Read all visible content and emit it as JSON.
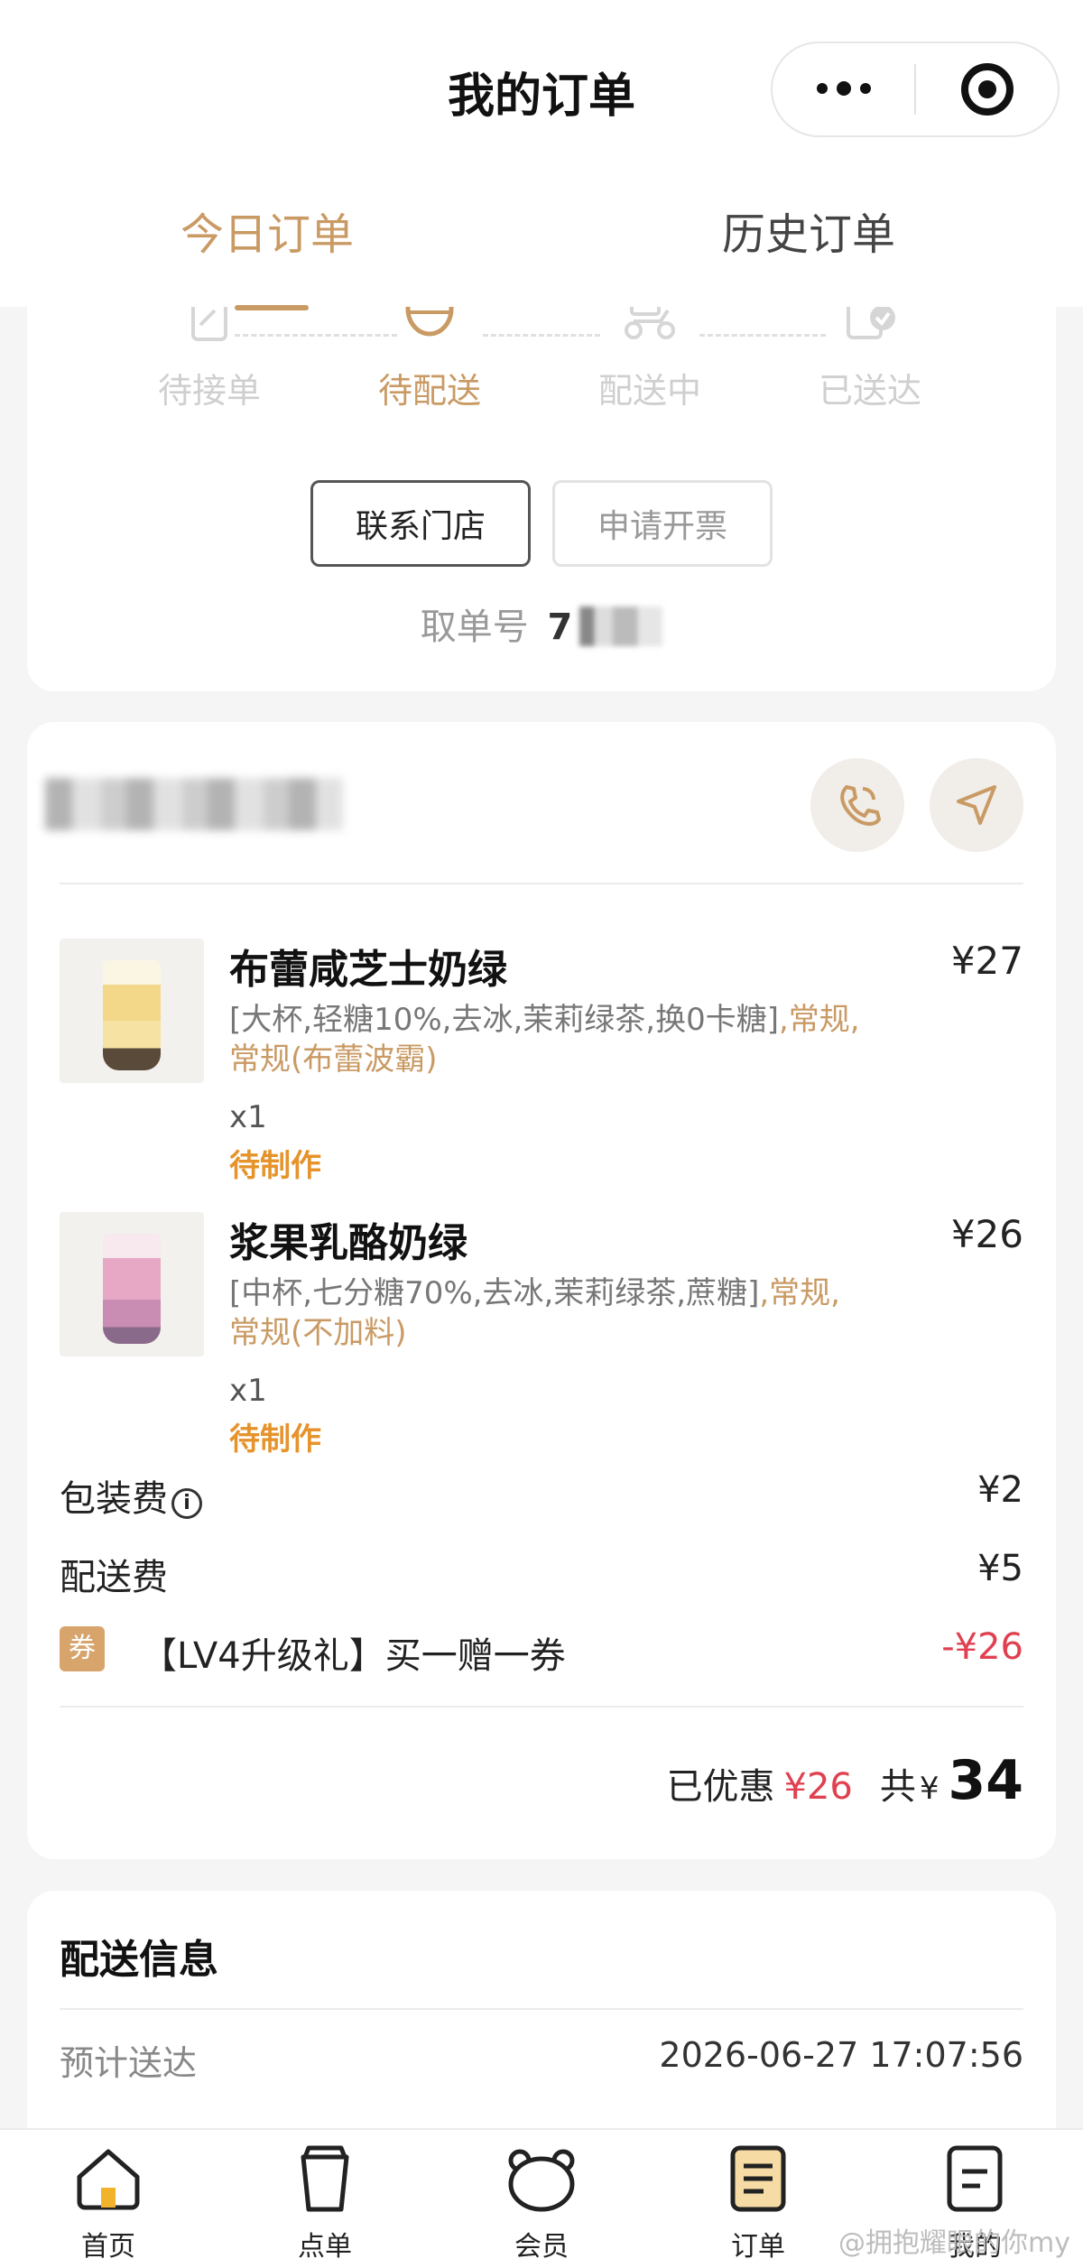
{
  "header": {
    "title": "我的订单",
    "tabs": [
      {
        "label": "今日订单",
        "active": true
      },
      {
        "label": "历史订单",
        "active": false
      }
    ],
    "accent_color": "#c99a64"
  },
  "progress": {
    "steps": [
      {
        "label": "待接单",
        "icon": "order-icon"
      },
      {
        "label": "待配送",
        "icon": "bag-icon"
      },
      {
        "label": "配送中",
        "icon": "scooter-icon"
      },
      {
        "label": "已送达",
        "icon": "delivered-icon"
      }
    ],
    "current": 1
  },
  "actions": {
    "contact_store": "联系门店",
    "request_invoice": "申请开票"
  },
  "pickup": {
    "label": "取单号",
    "number_visible": "7"
  },
  "items": [
    {
      "name": "布蕾咸芝士奶绿",
      "price": "¥27",
      "spec": "[大杯,轻糖10%,去冰,茉莉绿茶,换0卡糖]",
      "spec_extra": ",常规,常规(布蕾波霸)",
      "qty": "x1",
      "status": "待制作"
    },
    {
      "name": "浆果乳酪奶绿",
      "price": "¥26",
      "spec": "[中杯,七分糖70%,去冰,茉莉绿茶,蔗糖]",
      "spec_extra": ",常规,常规(不加料)",
      "qty": "x1",
      "status": "待制作"
    }
  ],
  "fees": {
    "packaging_label": "包装费",
    "packaging_value": "¥2",
    "delivery_label": "配送费",
    "delivery_value": "¥5",
    "coupon_badge": "券",
    "coupon_label": "【LV4升级礼】买一赠一券",
    "coupon_value": "-¥26"
  },
  "total": {
    "discount_label": "已优惠",
    "discount_value": "¥26",
    "total_label": "共",
    "currency": "¥",
    "total_value": "34"
  },
  "delivery_info": {
    "title": "配送信息",
    "eta_label": "预计送达",
    "eta_value": "2026-06-27 17:07:56"
  },
  "tabbar": [
    {
      "label": "首页",
      "icon": "home-icon"
    },
    {
      "label": "点单",
      "icon": "cup-icon"
    },
    {
      "label": "会员",
      "icon": "bear-icon"
    },
    {
      "label": "订单",
      "icon": "order-list-icon",
      "active": true
    },
    {
      "label": "我的",
      "icon": "profile-icon"
    }
  ],
  "watermark": "@拥抱耀眼的你my",
  "colors": {
    "accent": "#c99a64",
    "price_red": "#e04050",
    "status_orange": "#e5932a"
  }
}
